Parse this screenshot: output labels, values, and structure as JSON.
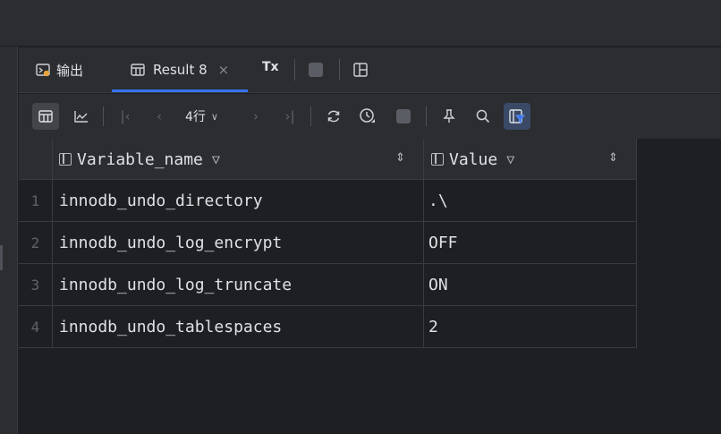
{
  "tabs": {
    "output_label": "输出",
    "result_label": "Result 8",
    "close_glyph": "×",
    "tx_label": "Tx"
  },
  "toolbar": {
    "rows_label": "4行"
  },
  "grid": {
    "columns": [
      "Variable_name",
      "Value"
    ],
    "rows": [
      {
        "num": "1",
        "name": "innodb_undo_directory",
        "value": ".\\"
      },
      {
        "num": "2",
        "name": "innodb_undo_log_encrypt",
        "value": "OFF"
      },
      {
        "num": "3",
        "name": "innodb_undo_log_truncate",
        "value": "ON"
      },
      {
        "num": "4",
        "name": "innodb_undo_tablespaces",
        "value": "2"
      }
    ]
  },
  "icons": {
    "output": "terminal-icon",
    "result": "table-icon",
    "view_switch": "window-layout-icon",
    "table_view": "table-view-icon",
    "chart_view": "chart-icon",
    "first": "first-page-icon",
    "prev": "prev-page-icon",
    "next": "next-page-icon",
    "last": "last-page-icon",
    "refresh": "refresh-icon",
    "history": "history-icon",
    "stop": "stop-icon",
    "pin": "pin-icon",
    "search": "search-icon",
    "filter_panel": "filter-panel-icon"
  },
  "colors": {
    "accent": "#3574f0",
    "background": "#1e1f22",
    "panel": "#2b2d30"
  }
}
